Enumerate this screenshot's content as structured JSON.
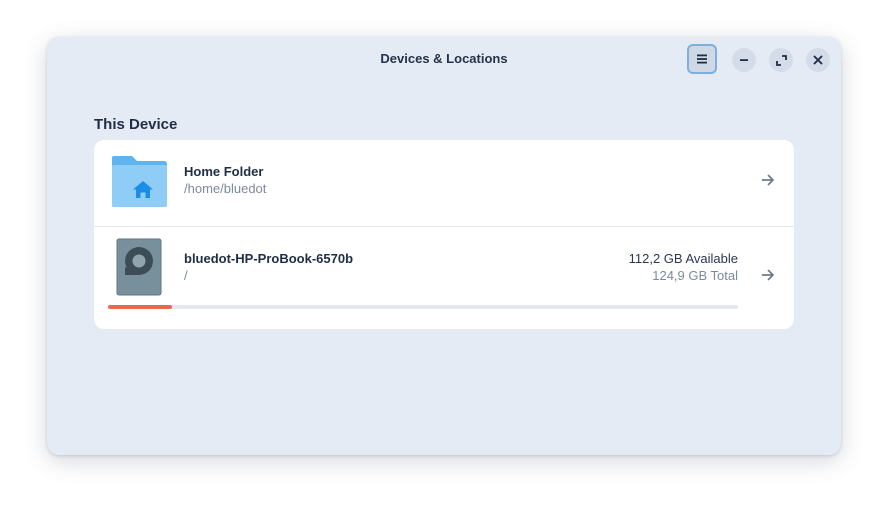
{
  "window": {
    "title": "Devices & Locations"
  },
  "headerbar": {
    "buttons": [
      {
        "name": "menu",
        "icon": "hamburger-menu-icon"
      },
      {
        "name": "minimize",
        "icon": "minimize-icon"
      },
      {
        "name": "maximize",
        "icon": "maximize-icon"
      },
      {
        "name": "close",
        "icon": "close-icon"
      }
    ]
  },
  "section": {
    "title": "This Device"
  },
  "locations": [
    {
      "name": "Home Folder",
      "path": "/home/bluedot",
      "icon": "home-folder-icon"
    },
    {
      "name": "bluedot-HP-ProBook-6570b",
      "path": "/",
      "icon": "hard-disk-icon",
      "available": "112,2 GB Available",
      "total": "124,9 GB Total",
      "used_fraction": 0.102
    }
  ],
  "colors": {
    "accent": "#7fb0dd",
    "usage_bar": "#e86a4a",
    "folder": "#8fcdf6",
    "disk": "#78909c"
  }
}
